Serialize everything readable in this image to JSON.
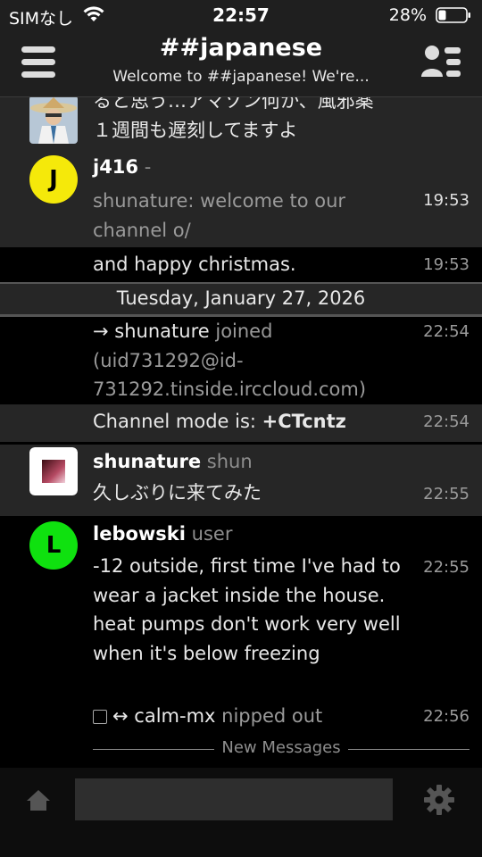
{
  "status_bar": {
    "carrier": "SIMなし",
    "time": "22:57",
    "battery": "28%"
  },
  "header": {
    "title": "##japanese",
    "topic": "Welcome to ##japanese! We're..."
  },
  "messages": [
    {
      "nick": "",
      "lines": [
        "ると思う…アマゾン何か、風邪薬",
        "１週間も遅刻してますよ"
      ],
      "time": ""
    },
    {
      "nick": "j416",
      "nick_sub": "-",
      "avatar_letter": "J",
      "text": "shunature: welcome to our channel o/",
      "time": "19:53"
    },
    {
      "text": "and happy christmas.",
      "time": "19:53"
    },
    {
      "date": "Tuesday, January 27, 2026"
    },
    {
      "arrow": "→",
      "nick": "shunature",
      "action": "joined",
      "host": "(uid731292@id-731292.tinside.irccloud.com)",
      "time": "22:54"
    },
    {
      "text_prefix": "Channel mode is: ",
      "mode": "+CTcntz",
      "time": "22:54"
    },
    {
      "nick": "shunature",
      "nick_sub": "shun",
      "text": "久しぶりに来てみた",
      "time": "22:55"
    },
    {
      "nick": "lebowski",
      "nick_sub": "user",
      "avatar_letter": "L",
      "text": "-12 outside, first time I've had to wear a jacket inside the house. heat pumps don't work very well when it's below freezing",
      "time": "22:55"
    },
    {
      "arrow": "↔",
      "nick": "calm-mx",
      "action": "nipped out",
      "time": "22:56"
    }
  ],
  "new_messages_label": "New Messages",
  "input": {
    "placeholder": ""
  },
  "colors": {
    "j416_avatar": "#f5e90a",
    "lebowski_avatar": "#0fe10f"
  }
}
